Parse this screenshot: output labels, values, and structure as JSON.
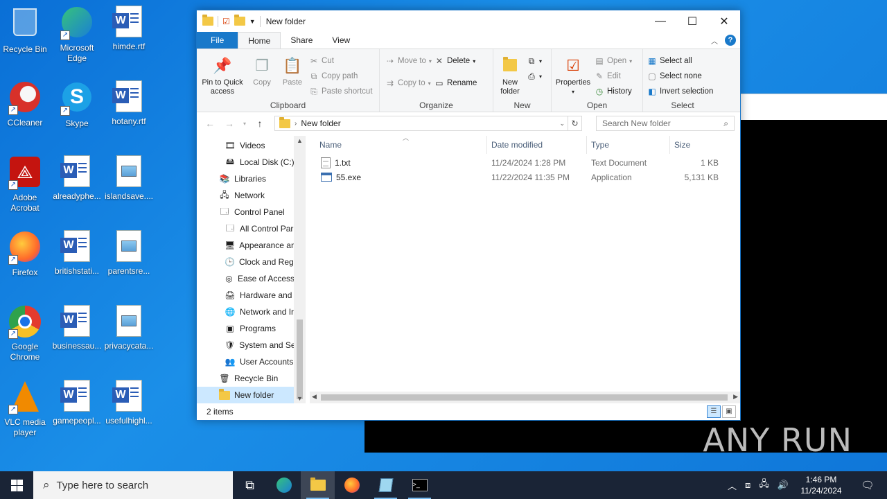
{
  "desktop": {
    "icons": [
      {
        "label": "Recycle Bin",
        "icon": "recycle-bin-icon"
      },
      {
        "label": "Microsoft Edge",
        "icon": "edge-icon"
      },
      {
        "label": "himde.rtf",
        "icon": "word-document-icon"
      },
      {
        "label": "CCleaner",
        "icon": "ccleaner-icon"
      },
      {
        "label": "Skype",
        "icon": "skype-icon"
      },
      {
        "label": "hotany.rtf",
        "icon": "word-document-icon"
      },
      {
        "label": "Adobe Acrobat",
        "icon": "acrobat-icon"
      },
      {
        "label": "alreadyphe...",
        "icon": "word-document-icon"
      },
      {
        "label": "islandsave....",
        "icon": "image-file-icon"
      },
      {
        "label": "Firefox",
        "icon": "firefox-icon"
      },
      {
        "label": "britishstati...",
        "icon": "word-document-icon"
      },
      {
        "label": "parentsre...",
        "icon": "image-file-icon"
      },
      {
        "label": "Google Chrome",
        "icon": "chrome-icon"
      },
      {
        "label": "businessau...",
        "icon": "word-document-icon"
      },
      {
        "label": "privacycata...",
        "icon": "image-file-icon"
      },
      {
        "label": "VLC media player",
        "icon": "vlc-icon"
      },
      {
        "label": "gamepeopl...",
        "icon": "word-document-icon"
      },
      {
        "label": "usefulhighl...",
        "icon": "word-document-icon"
      }
    ]
  },
  "explorer": {
    "title": "New folder",
    "tabs": [
      "File",
      "Home",
      "Share",
      "View"
    ],
    "ribbon": {
      "clipboard": {
        "label": "Clipboard",
        "pin": "Pin to Quick access",
        "copy": "Copy",
        "paste": "Paste",
        "cut": "Cut",
        "copy_path": "Copy path",
        "paste_shortcut": "Paste shortcut"
      },
      "organize": {
        "label": "Organize",
        "move_to": "Move to",
        "copy_to": "Copy to",
        "delete": "Delete",
        "rename": "Rename"
      },
      "new": {
        "label": "New",
        "new_folder": "New folder"
      },
      "open": {
        "label": "Open",
        "properties": "Properties",
        "open": "Open",
        "edit": "Edit",
        "history": "History"
      },
      "select": {
        "label": "Select",
        "select_all": "Select all",
        "select_none": "Select none",
        "invert_selection": "Invert selection"
      }
    },
    "address": {
      "path": "New folder",
      "search_placeholder": "Search New folder"
    },
    "nav_pane": [
      {
        "label": "Videos",
        "indent": 2,
        "icon": "videos-icon"
      },
      {
        "label": "Local Disk (C:)",
        "indent": 2,
        "icon": "drive-icon"
      },
      {
        "label": "Libraries",
        "indent": 1,
        "icon": "libraries-icon"
      },
      {
        "label": "Network",
        "indent": 1,
        "icon": "network-icon"
      },
      {
        "label": "Control Panel",
        "indent": 1,
        "icon": "control-panel-icon"
      },
      {
        "label": "All Control Par",
        "indent": 2,
        "icon": "control-panel-icon"
      },
      {
        "label": "Appearance an",
        "indent": 2,
        "icon": "appearance-icon"
      },
      {
        "label": "Clock and Regi",
        "indent": 2,
        "icon": "clock-icon"
      },
      {
        "label": "Ease of Access",
        "indent": 2,
        "icon": "ease-of-access-icon"
      },
      {
        "label": "Hardware and",
        "indent": 2,
        "icon": "hardware-icon"
      },
      {
        "label": "Network and Ir",
        "indent": 2,
        "icon": "network-internet-icon"
      },
      {
        "label": "Programs",
        "indent": 2,
        "icon": "programs-icon"
      },
      {
        "label": "System and Se",
        "indent": 2,
        "icon": "system-security-icon"
      },
      {
        "label": "User Accounts",
        "indent": 2,
        "icon": "user-accounts-icon"
      },
      {
        "label": "Recycle Bin",
        "indent": 1,
        "icon": "recycle-bin-icon"
      },
      {
        "label": "New folder",
        "indent": 1,
        "icon": "folder-icon",
        "selected": true
      }
    ],
    "columns": [
      "Name",
      "Date modified",
      "Type",
      "Size"
    ],
    "files": [
      {
        "name": "1.txt",
        "date": "11/24/2024 1:28 PM",
        "type": "Text Document",
        "size": "1 KB",
        "icon": "text-file-icon"
      },
      {
        "name": "55.exe",
        "date": "11/22/2024 11:35 PM",
        "type": "Application",
        "size": "5,131 KB",
        "icon": "exe-file-icon"
      }
    ],
    "status": "2 items"
  },
  "watermark": "ANY RUN",
  "taskbar": {
    "search_placeholder": "Type here to search",
    "apps": [
      "task-view-icon",
      "edge-icon",
      "file-explorer-icon",
      "firefox-icon",
      "notepad-icon",
      "terminal-icon"
    ],
    "time": "1:46 PM",
    "date": "11/24/2024"
  },
  "colors": {
    "desktop_blue": "#0f76d8",
    "accent": "#1979ca",
    "selection": "#cce8ff",
    "taskbar": "#1a2436"
  }
}
